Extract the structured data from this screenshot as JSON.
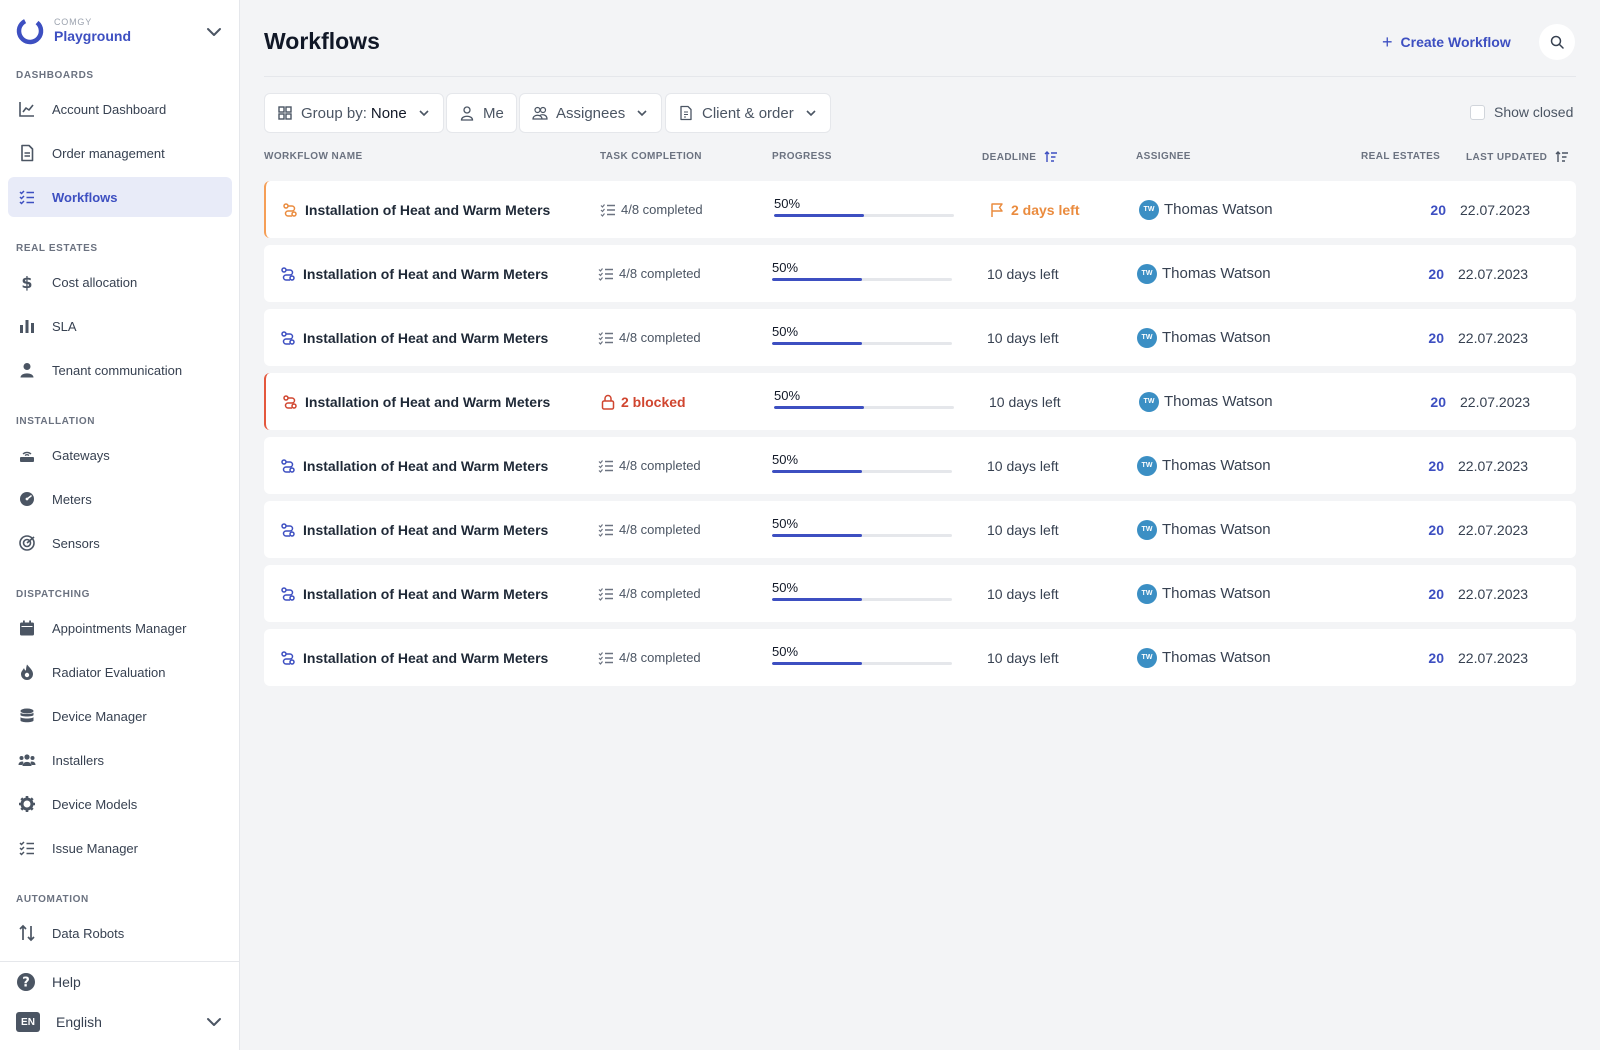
{
  "brand": {
    "company": "COMGY",
    "workspace": "Playground"
  },
  "sidebar": {
    "sections": [
      {
        "title": "DASHBOARDS",
        "items": [
          {
            "label": "Account Dashboard",
            "icon": "chart-line-icon"
          },
          {
            "label": "Order management",
            "icon": "document-icon"
          },
          {
            "label": "Workflows",
            "icon": "list-check-icon",
            "active": true
          }
        ]
      },
      {
        "title": "REAL ESTATES",
        "items": [
          {
            "label": "Cost allocation",
            "icon": "dollar-icon"
          },
          {
            "label": "SLA",
            "icon": "bar-chart-icon"
          },
          {
            "label": "Tenant communication",
            "icon": "person-icon"
          }
        ]
      },
      {
        "title": "INSTALLATION",
        "items": [
          {
            "label": "Gateways",
            "icon": "router-icon"
          },
          {
            "label": "Meters",
            "icon": "meter-icon"
          },
          {
            "label": "Sensors",
            "icon": "sensor-icon"
          }
        ]
      },
      {
        "title": "DISPATCHING",
        "items": [
          {
            "label": "Appointments Manager",
            "icon": "calendar-icon"
          },
          {
            "label": "Radiator Evaluation",
            "icon": "flame-icon"
          },
          {
            "label": "Device Manager",
            "icon": "database-icon"
          },
          {
            "label": "Installers",
            "icon": "group-icon"
          },
          {
            "label": "Device Models",
            "icon": "gear-icon"
          },
          {
            "label": "Issue Manager",
            "icon": "list-check-icon"
          }
        ]
      },
      {
        "title": "AUTOMATION",
        "items": [
          {
            "label": "Data Robots",
            "icon": "arrows-updown-icon"
          }
        ]
      }
    ],
    "help_label": "Help",
    "language": {
      "code": "EN",
      "label": "English"
    }
  },
  "header": {
    "title": "Workflows",
    "create_label": "Create Workflow"
  },
  "filters": {
    "group_by_label": "Group by:",
    "group_by_value": "None",
    "me_label": "Me",
    "assignees_label": "Assignees",
    "client_order_label": "Client & order",
    "show_closed_label": "Show closed",
    "show_closed_checked": false
  },
  "table": {
    "columns": {
      "name": "WORKFLOW NAME",
      "task": "TASK COMPLETION",
      "progress": "PROGRESS",
      "deadline": "DEADLINE",
      "assignee": "ASSIGNEE",
      "real_estates": "REAL ESTATES",
      "updated": "LAST UPDATED"
    },
    "rows": [
      {
        "name": "Installation of Heat and Warm Meters",
        "status": "warning",
        "task": "4/8 completed",
        "progress": "50%",
        "progress_value": 0.5,
        "deadline": "2 days left",
        "assignee_initials": "TW",
        "assignee": "Thomas Watson",
        "real_estates": "20",
        "updated": "22.07.2023"
      },
      {
        "name": "Installation of Heat and Warm Meters",
        "status": "normal",
        "task": "4/8 completed",
        "progress": "50%",
        "progress_value": 0.5,
        "deadline": "10 days left",
        "assignee_initials": "TW",
        "assignee": "Thomas Watson",
        "real_estates": "20",
        "updated": "22.07.2023"
      },
      {
        "name": "Installation of Heat and Warm Meters",
        "status": "normal",
        "task": "4/8 completed",
        "progress": "50%",
        "progress_value": 0.5,
        "deadline": "10 days left",
        "assignee_initials": "TW",
        "assignee": "Thomas Watson",
        "real_estates": "20",
        "updated": "22.07.2023"
      },
      {
        "name": "Installation of Heat and Warm Meters",
        "status": "blocked",
        "task": "2 blocked",
        "progress": "50%",
        "progress_value": 0.5,
        "deadline": "10 days left",
        "assignee_initials": "TW",
        "assignee": "Thomas Watson",
        "real_estates": "20",
        "updated": "22.07.2023"
      },
      {
        "name": "Installation of Heat and Warm Meters",
        "status": "normal",
        "task": "4/8 completed",
        "progress": "50%",
        "progress_value": 0.5,
        "deadline": "10 days left",
        "assignee_initials": "TW",
        "assignee": "Thomas Watson",
        "real_estates": "20",
        "updated": "22.07.2023"
      },
      {
        "name": "Installation of Heat and Warm Meters",
        "status": "normal",
        "task": "4/8 completed",
        "progress": "50%",
        "progress_value": 0.5,
        "deadline": "10 days left",
        "assignee_initials": "TW",
        "assignee": "Thomas Watson",
        "real_estates": "20",
        "updated": "22.07.2023"
      },
      {
        "name": "Installation of Heat and Warm Meters",
        "status": "normal",
        "task": "4/8 completed",
        "progress": "50%",
        "progress_value": 0.5,
        "deadline": "10 days left",
        "assignee_initials": "TW",
        "assignee": "Thomas Watson",
        "real_estates": "20",
        "updated": "22.07.2023"
      },
      {
        "name": "Installation of Heat and Warm Meters",
        "status": "normal",
        "task": "4/8 completed",
        "progress": "50%",
        "progress_value": 0.5,
        "deadline": "10 days left",
        "assignee_initials": "TW",
        "assignee": "Thomas Watson",
        "real_estates": "20",
        "updated": "22.07.2023"
      }
    ]
  },
  "colors": {
    "accent": "#3d4fc1",
    "warning": "#ea8b3e",
    "danger": "#d0452f",
    "avatar": "#3b8fc4"
  }
}
